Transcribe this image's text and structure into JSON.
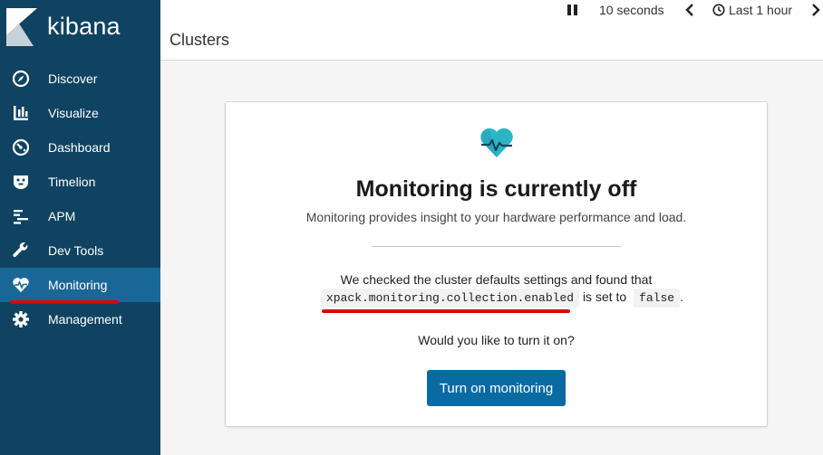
{
  "app": {
    "name": "kibana"
  },
  "sidebar": {
    "items": [
      {
        "label": "Discover",
        "icon": "compass-icon"
      },
      {
        "label": "Visualize",
        "icon": "bar-chart-icon"
      },
      {
        "label": "Dashboard",
        "icon": "dashboard-gauge-icon"
      },
      {
        "label": "Timelion",
        "icon": "timelion-bear-icon"
      },
      {
        "label": "APM",
        "icon": "apm-lines-icon"
      },
      {
        "label": "Dev Tools",
        "icon": "wrench-icon"
      },
      {
        "label": "Monitoring",
        "icon": "heartbeat-icon",
        "active": true
      },
      {
        "label": "Management",
        "icon": "gear-icon"
      }
    ]
  },
  "header": {
    "title": "Clusters",
    "refresh_interval": "10 seconds",
    "time_range": "Last 1 hour"
  },
  "card": {
    "title": "Monitoring is currently off",
    "subtitle": "Monitoring provides insight to your hardware performance and load.",
    "checked_text": "We checked the cluster defaults settings and found that",
    "setting_name": "xpack.monitoring.collection.enabled",
    "is_set_to": "is set to",
    "setting_value": "false",
    "period": ".",
    "question": "Would you like to turn it on?",
    "button_label": "Turn on monitoring"
  },
  "colors": {
    "sidebar_bg": "#0f4361",
    "sidebar_active": "#1a6797",
    "primary_button": "#0a6ba3",
    "annotation_red": "#e00000",
    "heart_teal": "#2bb5c6"
  }
}
